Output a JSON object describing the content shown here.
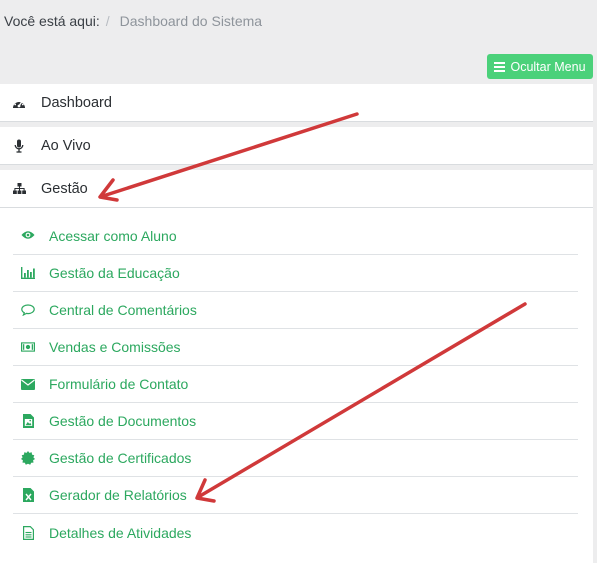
{
  "breadcrumb": {
    "prefix": "Você está aqui:",
    "separator": "/",
    "current": "Dashboard do Sistema"
  },
  "hide_menu_button": {
    "label": "Ocultar Menu",
    "icon": "bars-icon"
  },
  "menu": [
    {
      "label": "Dashboard",
      "icon": "dashboard-icon"
    },
    {
      "label": "Ao Vivo",
      "icon": "microphone-icon"
    },
    {
      "label": "Gestão",
      "icon": "sitemap-icon"
    }
  ],
  "submenu": [
    {
      "label": "Acessar como Aluno",
      "icon": "eye-icon"
    },
    {
      "label": "Gestão da Educação",
      "icon": "bar-chart-icon"
    },
    {
      "label": "Central de Comentários",
      "icon": "comment-icon"
    },
    {
      "label": "Vendas e Comissões",
      "icon": "money-icon"
    },
    {
      "label": "Formulário de Contato",
      "icon": "envelope-icon"
    },
    {
      "label": "Gestão de Documentos",
      "icon": "image-file-icon"
    },
    {
      "label": "Gestão de Certificados",
      "icon": "certificate-icon"
    },
    {
      "label": "Gerador de Relatórios",
      "icon": "excel-file-icon"
    },
    {
      "label": "Detalhes de Atividades",
      "icon": "text-file-icon"
    }
  ],
  "colors": {
    "accent_green": "#2ca85f",
    "button_green": "#4bd17a",
    "annotation_arrow": "#d0393a"
  }
}
